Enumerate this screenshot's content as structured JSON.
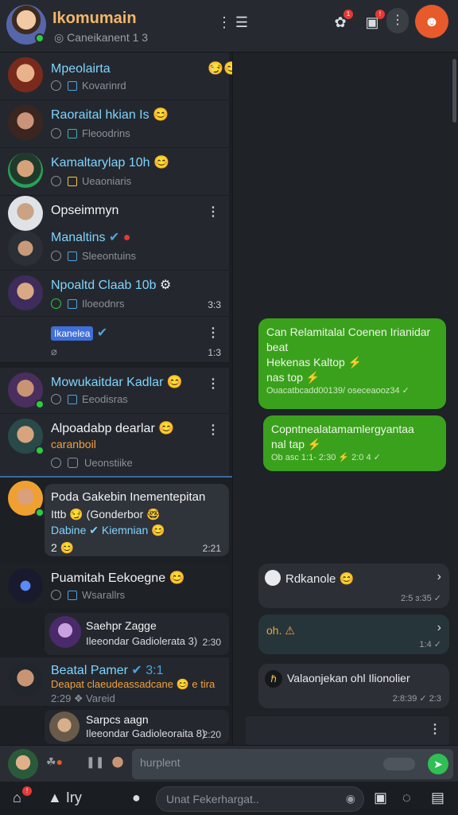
{
  "header": {
    "title": "Ikomumain",
    "subtitle": "Caneikanent 1 3",
    "icons": [
      "star-icon",
      "list-icon",
      "puzzle-icon",
      "media-icon",
      "more-icon",
      "profile-icon"
    ]
  },
  "chats": [
    {
      "name": "Mpeolairta",
      "emoji": "😏😊",
      "sub": "Kovarinrd"
    },
    {
      "name": "Raoraital hkian Is",
      "emoji": "😊",
      "sub": "Fleoodrins"
    },
    {
      "name": "Kamaltarylap 10h",
      "emoji": "😊",
      "sub": "Ueaoniaris"
    },
    {
      "name": "Opseimmyn",
      "emoji": "",
      "sub": ""
    },
    {
      "name": "Manaltins",
      "emoji": "✔",
      "sub": "Sleeontuins"
    },
    {
      "name": "Npoaltd Claab 10b",
      "emoji": "⚙",
      "sub": "Iloeodnrs",
      "time": "3:3"
    },
    {
      "name": "Ikanelea",
      "emoji": "",
      "sub": "",
      "time": "1:3"
    },
    {
      "name": "Mowukaitdar Kadlar",
      "emoji": "😊",
      "sub": "Eeodisras"
    },
    {
      "name": "Alpoadabp dearlar",
      "emoji": "😊",
      "sub2": "caranboil",
      "sub": "Ueonstiike"
    },
    {
      "name": "Poda Gakebin Inementepitan",
      "line2": "Ittb 😏 (Gonderbor 🤓",
      "line3": "Dabine ✔ Kiemnian 😊",
      "line4": "2 😊",
      "time": "2:21"
    },
    {
      "name": "Puamitah Eekoegne",
      "emoji": "😊",
      "sub": "Wsarallrs"
    },
    {
      "name": "Saehpr Zagge",
      "sub": "Ileeondar Gadiolerata 3)",
      "time": "2:30"
    },
    {
      "name": "Beatal Pamer",
      "emoji": "✔ 3:1",
      "sub2": "Deapat claeudeassadcane 😊 e tira",
      "sub": "2:29 ❖ Vareid"
    },
    {
      "name": "Sarpcs aagn",
      "sub": "Ileeondar Gadioleoraita 8)",
      "time": "2:20"
    }
  ],
  "messages": [
    {
      "lines": [
        "Can Relamitalal Coenen Irianidar",
        "beat",
        "Hekenas Kaltop ⚡",
        "nas top ⚡"
      ],
      "meta": "Ouacatbcadd00139/ oseceaooz34 ✓"
    },
    {
      "lines": [
        "Copntnealatamamlergyantaa",
        "nal tap ⚡"
      ],
      "meta": "Ob asc 1:1- 2:30 ⚡   2:0 4 ✓"
    }
  ],
  "mini": [
    {
      "name": "Rdkanole",
      "emoji": "😊",
      "time": "2:5 ɜ:35 ✓"
    },
    {
      "name": "oh. ⚠",
      "time": "1:4 ✓"
    },
    {
      "name": "Valaonjekan ohl Ilionolier",
      "time": "2:8:39 ✓ 2:3"
    }
  ],
  "compose": {
    "placeholder": "hurplent"
  },
  "search": {
    "placeholder": "Unat Fekerhargat.."
  },
  "nav": {
    "label": "Iry"
  }
}
